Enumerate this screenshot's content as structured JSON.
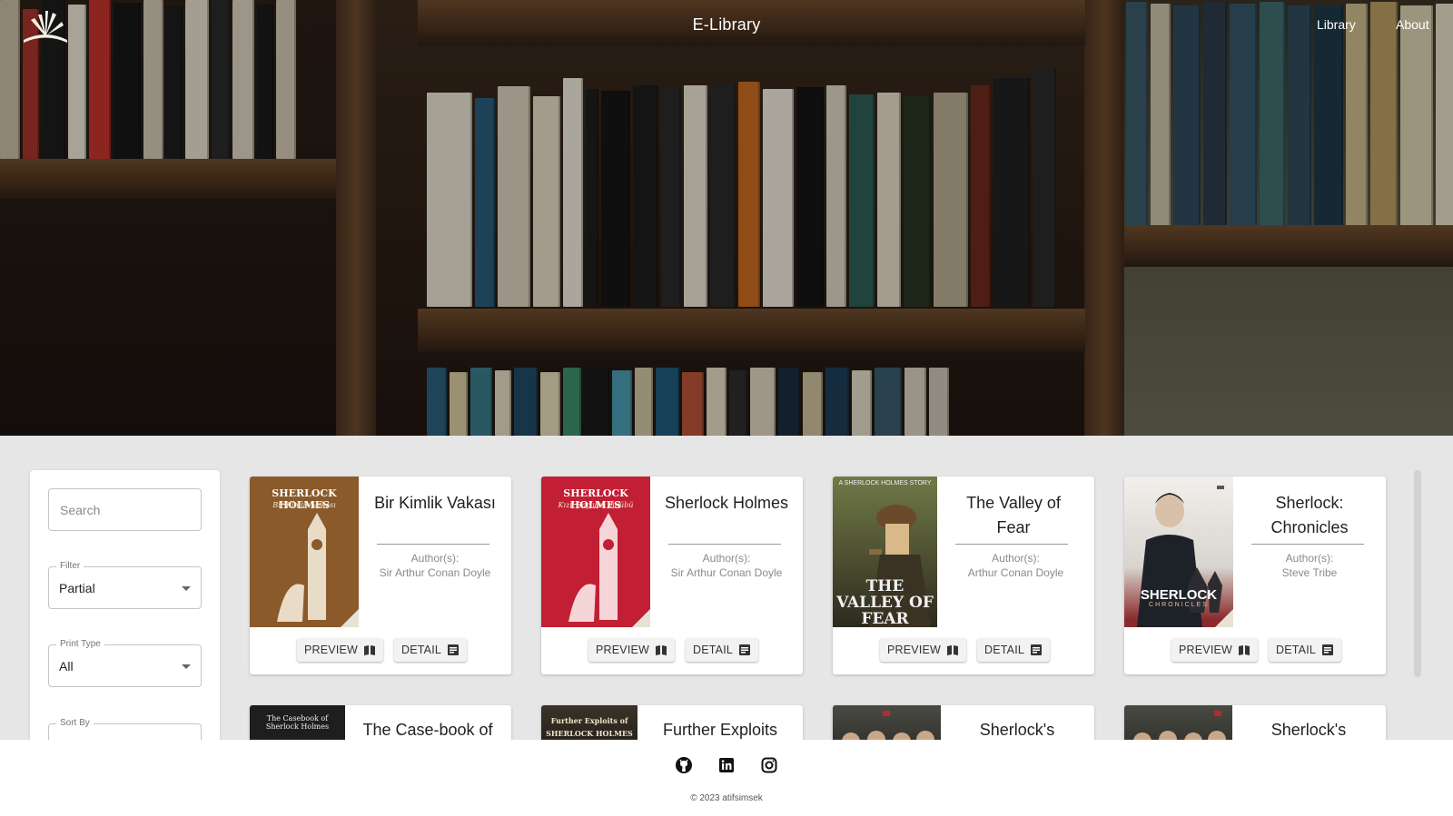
{
  "nav": {
    "brand": "E-Library",
    "links": [
      "Library",
      "About"
    ]
  },
  "sidebar": {
    "search_placeholder": "Search",
    "filter": {
      "label": "Filter",
      "value": "Partial"
    },
    "print_type": {
      "label": "Print Type",
      "value": "All"
    },
    "sort_by": {
      "label": "Sort By",
      "value": ""
    }
  },
  "books": [
    {
      "title": "Bir Kimlik Vakası",
      "author_label": "Author(s):",
      "author": "Sir Arthur Conan Doyle",
      "cover_title": "SHERLOCK HOLMES",
      "cover_subtitle": "Bir Kimlik Vakası",
      "cover_color": "#8a5a2b"
    },
    {
      "title": "Sherlock Holmes",
      "author_label": "Author(s):",
      "author": "Sir Arthur Conan Doyle",
      "cover_title": "SHERLOCK HOLMES",
      "cover_subtitle": "Kızıl Saçlılar Kulübü",
      "cover_color": "#c21f34"
    },
    {
      "title": "The Valley of Fear",
      "author_label": "Author(s):",
      "author": "Arthur Conan Doyle",
      "cover_title": "THE VALLEY OF FEAR",
      "cover_subtitle": "A SHERLOCK HOLMES STORY",
      "cover_color": "#5c6a3a"
    },
    {
      "title": "Sherlock: Chronicles",
      "author_label": "Author(s):",
      "author": "Steve Tribe",
      "cover_title": "SHERLOCK",
      "cover_subtitle": "CHRONICLES",
      "cover_color": "#e3e0dc"
    }
  ],
  "books_row2": [
    {
      "title": "The Case-book of",
      "cover_title": "The Casebook of Sherlock Holmes",
      "cover_color": "#1e1e1e"
    },
    {
      "title": "Further Exploits",
      "cover_title": "Further Exploits of SHERLOCK HOLMES",
      "cover_color": "#2a2620"
    },
    {
      "title": "Sherlock's",
      "cover_title": "",
      "cover_color": "#3a3a36"
    },
    {
      "title": "Sherlock's",
      "cover_title": "",
      "cover_color": "#3a3a36"
    }
  ],
  "buttons": {
    "preview": "PREVIEW",
    "detail": "DETAIL"
  },
  "footer": {
    "icons": [
      "github-icon",
      "linkedin-icon",
      "instagram-icon"
    ],
    "copyright": "© 2023 atifsimsek"
  }
}
